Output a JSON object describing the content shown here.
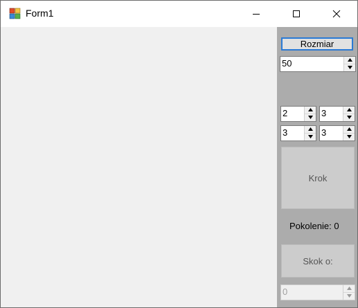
{
  "window": {
    "title": "Form1"
  },
  "controls": {
    "rozmiar_button": "Rozmiar",
    "size_value": "50",
    "rule_values": [
      "2",
      "3",
      "3",
      "3"
    ],
    "step_button": "Krok",
    "generation_label": "Pokolenie: 0",
    "jump_button": "Skok o:",
    "jump_value": "0"
  },
  "colors": {
    "panel": "#acacac",
    "client": "#f0f0f0",
    "focus_border": "#2a7ad5"
  },
  "icons": [
    "app-icon",
    "minimize-icon",
    "maximize-icon",
    "close-icon",
    "spin-up-icon",
    "spin-down-icon"
  ]
}
